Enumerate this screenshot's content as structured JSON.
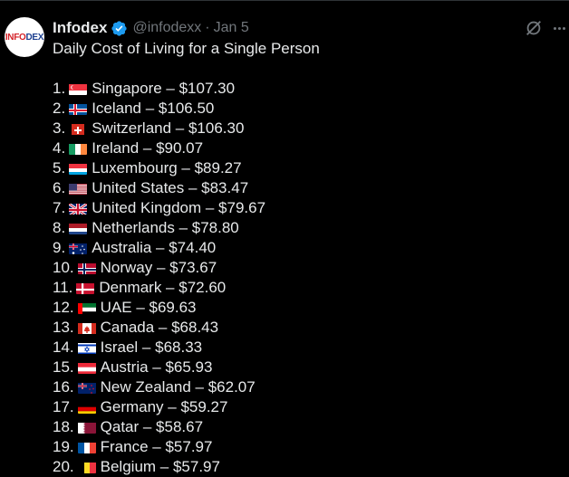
{
  "author": {
    "display_name": "Infodex",
    "handle": "@infodexx",
    "separator": "·",
    "date": "Jan 5",
    "avatar_text_1": "INFO",
    "avatar_text_2": "DEX"
  },
  "tweet": {
    "text": "Daily Cost of Living for a Single Person"
  },
  "icons": {
    "verified": "verified-badge-icon",
    "grok": "grok-icon",
    "more": "more-options-icon"
  },
  "colors": {
    "background": "#000000",
    "text": "#e7e9ea",
    "muted": "#71767b",
    "verified": "#1d9bf0"
  },
  "items": [
    {
      "rank": "1.",
      "flag": "sg",
      "label": "Singapore – $107.30"
    },
    {
      "rank": "2.",
      "flag": "is",
      "label": "Iceland – $106.50"
    },
    {
      "rank": "3.",
      "flag": "ch",
      "label": "Switzerland – $106.30"
    },
    {
      "rank": "4.",
      "flag": "ie",
      "label": "Ireland – $90.07"
    },
    {
      "rank": "5.",
      "flag": "lu",
      "label": "Luxembourg – $89.27"
    },
    {
      "rank": "6.",
      "flag": "us",
      "label": "United States – $83.47"
    },
    {
      "rank": "7.",
      "flag": "gb",
      "label": "United Kingdom – $79.67"
    },
    {
      "rank": "8.",
      "flag": "nl",
      "label": "Netherlands – $78.80"
    },
    {
      "rank": "9.",
      "flag": "au",
      "label": "Australia – $74.40"
    },
    {
      "rank": "10.",
      "flag": "no",
      "label": "Norway – $73.67"
    },
    {
      "rank": "11.",
      "flag": "dk",
      "label": "Denmark – $72.60"
    },
    {
      "rank": "12.",
      "flag": "ae",
      "label": "UAE – $69.63"
    },
    {
      "rank": "13.",
      "flag": "ca",
      "label": "Canada – $68.43"
    },
    {
      "rank": "14.",
      "flag": "il",
      "label": "Israel – $68.33"
    },
    {
      "rank": "15.",
      "flag": "at",
      "label": "Austria – $65.93"
    },
    {
      "rank": "16.",
      "flag": "nz",
      "label": "New Zealand – $62.07"
    },
    {
      "rank": "17.",
      "flag": "de",
      "label": "Germany – $59.27"
    },
    {
      "rank": "18.",
      "flag": "qa",
      "label": "Qatar – $58.67"
    },
    {
      "rank": "19.",
      "flag": "fr",
      "label": "France – $57.97"
    },
    {
      "rank": "20.",
      "flag": "be",
      "label": "Belgium – $57.97"
    }
  ]
}
